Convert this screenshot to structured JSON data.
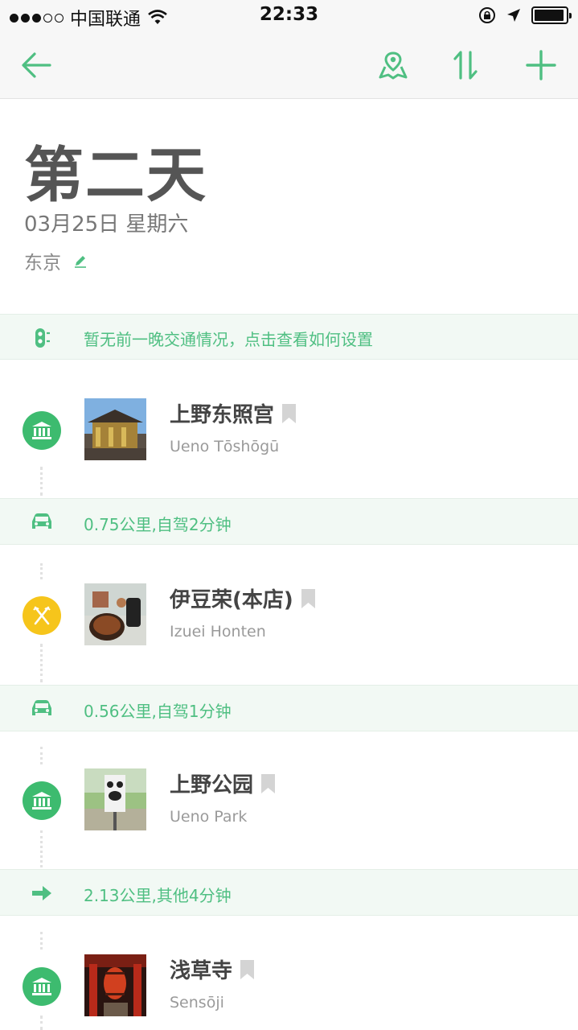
{
  "status": {
    "carrier": "中国联通",
    "time": "22:33",
    "signal_level": 3,
    "signal_total": 5,
    "battery_level": 0.95
  },
  "nav": {
    "back_icon": "arrow-left-icon",
    "map_icon": "map-pin-icon",
    "sort_icon": "sort-updown-icon",
    "add_icon": "plus-icon",
    "accent": "#4fbf82"
  },
  "header": {
    "title": "第二天",
    "date": "03月25日 星期六",
    "city": "东京"
  },
  "notice": {
    "text": "暂无前一晚交通情况，点击查看如何设置"
  },
  "itinerary": [
    {
      "name": "上野东照宫",
      "subtitle": "Ueno Tōshōgū",
      "category": "sight",
      "icon": "museum-icon",
      "color": "#3dbb6f"
    },
    {
      "transit": "0.75公里,自驾2分钟",
      "icon": "car-icon"
    },
    {
      "name": "伊豆荣(本店)",
      "subtitle": "Izuei Honten",
      "category": "food",
      "icon": "fork-knife-icon",
      "color": "#f6c51b"
    },
    {
      "transit": "0.56公里,自驾1分钟",
      "icon": "car-icon"
    },
    {
      "name": "上野公园",
      "subtitle": "Ueno Park",
      "category": "sight",
      "icon": "museum-icon",
      "color": "#3dbb6f"
    },
    {
      "transit": "2.13公里,其他4分钟",
      "icon": "arrow-right-icon"
    },
    {
      "name": "浅草寺",
      "subtitle": "Sensōji",
      "category": "sight",
      "icon": "museum-icon",
      "color": "#3dbb6f"
    }
  ]
}
